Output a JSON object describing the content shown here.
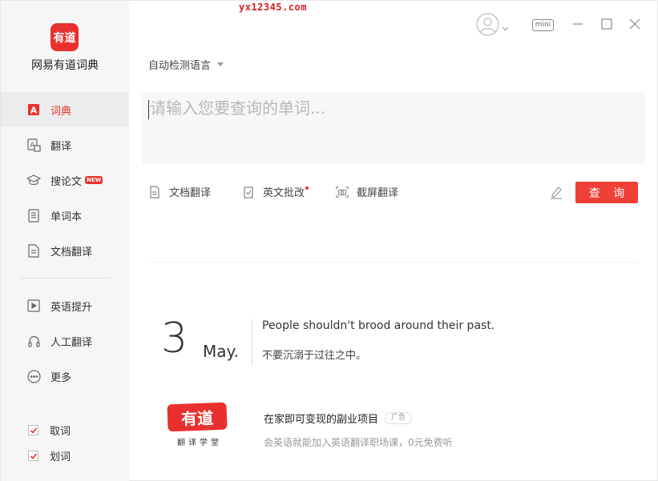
{
  "watermark": "yx12345.com",
  "app": {
    "logo_text": "有道",
    "name": "网易有道词典"
  },
  "sidebar": {
    "items": [
      {
        "label": "词典",
        "icon": "dictionary-icon",
        "active": true
      },
      {
        "label": "翻译",
        "icon": "translate-icon",
        "active": false
      },
      {
        "label": "搜论文",
        "icon": "graduation-cap-icon",
        "badge": "NEW",
        "active": false
      },
      {
        "label": "单词本",
        "icon": "wordbook-icon",
        "active": false
      },
      {
        "label": "文档翻译",
        "icon": "document-icon",
        "active": false
      },
      {
        "label": "英语提升",
        "icon": "video-icon",
        "active": false
      },
      {
        "label": "人工翻译",
        "icon": "headset-icon",
        "active": false
      },
      {
        "label": "更多",
        "icon": "more-icon",
        "active": false
      }
    ],
    "checks": [
      {
        "label": "取词",
        "checked": true
      },
      {
        "label": "划词",
        "checked": true
      }
    ]
  },
  "titlebar": {
    "mini_label": "mini"
  },
  "search": {
    "language": "自动检测语言",
    "placeholder": "请输入您要查询的单词..."
  },
  "tools": [
    {
      "label": "文档翻译",
      "icon": "document-icon"
    },
    {
      "label": "英文批改",
      "icon": "correction-icon",
      "dot": true
    },
    {
      "label": "截屏翻译",
      "icon": "screenshot-icon"
    }
  ],
  "query_label": "查 询",
  "daily": {
    "day": "3",
    "month": "May.",
    "sentence_en": "People shouldn't brood around their past.",
    "sentence_zh": "不要沉溺于过往之中。"
  },
  "ad": {
    "logo_text": "有道",
    "logo_sub": "翻译学堂",
    "title": "在家即可变现的副业项目",
    "tag": "广告",
    "desc": "会英语就能加入英语翻译职场课，0元免费听"
  },
  "colors": {
    "brand": "#e8312e",
    "sidebar_bg": "#f6f6f6",
    "search_bg": "#f7f7f7"
  }
}
